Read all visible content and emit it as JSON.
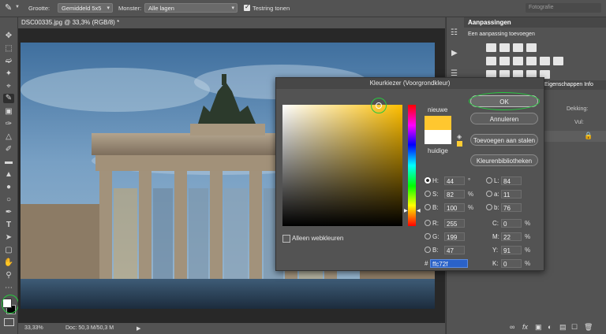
{
  "options_bar": {
    "size_label": "Grootte:",
    "size_value": "Gemiddeld 5x5",
    "sample_label": "Monster:",
    "sample_value": "Alle lagen",
    "show_ring_label": "Testring tonen",
    "workspace_value": "Fotografie"
  },
  "document": {
    "tab_title": "DSC00335.jpg @ 33,3% (RGB/8) *",
    "zoom": "33,33%",
    "doc_info": "Doc: 50,3 M/50,3 M"
  },
  "panels": {
    "adjustments_title": "Aanpassingen",
    "adjustments_subtitle": "Een aanpassing toevoegen",
    "layers_tabs": "Eigenschappen  Info",
    "opacity_label": "Dekking:",
    "fill_label": "Vul:"
  },
  "color_picker": {
    "title": "Kleurkiezer (Voorgrondkleur)",
    "new_label": "nieuwe",
    "current_label": "huidige",
    "ok_label": "OK",
    "cancel_label": "Annuleren",
    "add_swatches_label": "Toevoegen aan stalen",
    "libraries_label": "Kleurenbibliotheken",
    "web_colors_label": "Alleen webkleuren",
    "new_color": "#ffc72f",
    "current_color": "#ffffff",
    "hsb": [
      {
        "label": "H:",
        "value": "44",
        "unit": "°"
      },
      {
        "label": "S:",
        "value": "82",
        "unit": "%"
      },
      {
        "label": "B:",
        "value": "100",
        "unit": "%"
      }
    ],
    "rgb": [
      {
        "label": "R:",
        "value": "255"
      },
      {
        "label": "G:",
        "value": "199"
      },
      {
        "label": "B:",
        "value": "47"
      }
    ],
    "lab": [
      {
        "label": "L:",
        "value": "84"
      },
      {
        "label": "a:",
        "value": "11"
      },
      {
        "label": "b:",
        "value": "76"
      }
    ],
    "cmyk": [
      {
        "label": "C:",
        "value": "0",
        "unit": "%"
      },
      {
        "label": "M:",
        "value": "22",
        "unit": "%"
      },
      {
        "label": "Y:",
        "value": "91",
        "unit": "%"
      },
      {
        "label": "K:",
        "value": "0",
        "unit": "%"
      }
    ],
    "hex_label": "#",
    "hex_value": "ffc72f"
  },
  "colors": {
    "accent_highlight": "#27c93f",
    "hex_selection": "#2a62c9"
  }
}
